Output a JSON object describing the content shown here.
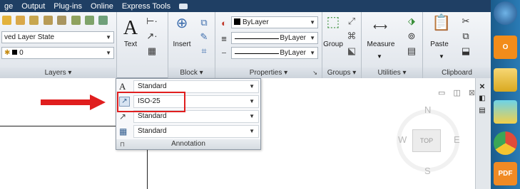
{
  "menubar": {
    "items": [
      "ge",
      "Output",
      "Plug-ins",
      "Online",
      "Express Tools"
    ]
  },
  "ribbon": {
    "layers": {
      "layer_state": "ved Layer State",
      "current_layer": "0",
      "title": "Layers"
    },
    "annotation": {
      "text_label": "Text"
    },
    "block": {
      "insert_label": "Insert",
      "title": "Block"
    },
    "properties": {
      "color": "ByLayer",
      "linetype": "ByLayer",
      "lineweight": "ByLayer",
      "title": "Properties"
    },
    "groups": {
      "group_label": "Group",
      "title": "Groups"
    },
    "utilities": {
      "measure_label": "Measure",
      "title": "Utilities"
    },
    "clipboard": {
      "paste_label": "Paste",
      "title": "Clipboard"
    }
  },
  "annotation_dropdown": {
    "rows": [
      {
        "value": "Standard",
        "icon": "text-style-icon"
      },
      {
        "value": "ISO-25",
        "icon": "dimension-style-icon"
      },
      {
        "value": "Standard",
        "icon": "multileader-style-icon"
      },
      {
        "value": "Standard",
        "icon": "table-style-icon"
      }
    ],
    "footer": "Annotation"
  },
  "viewcube": {
    "north": "N",
    "south": "S",
    "east": "E",
    "west": "W",
    "top": "TOP"
  },
  "taskbar": {
    "pdf_label": "PDF"
  },
  "colors": {
    "menubar_bg": "#1f3f64",
    "highlight": "#e01e1e",
    "accent_blue": "#2a7bb5"
  }
}
